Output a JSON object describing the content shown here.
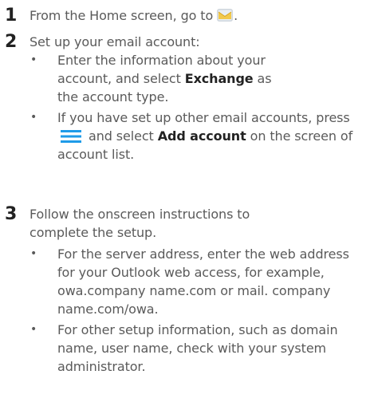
{
  "steps": [
    {
      "number": "1",
      "text_before": "From the Home screen, go to",
      "icon": "mail-app-icon",
      "text_after": "."
    },
    {
      "number": "2",
      "text": "Set up your email account:",
      "bullets": [
        {
          "part1": "Enter the information about your account, and select ",
          "bold1": "Exchange",
          "part2": " as the account type."
        },
        {
          "part1": "If you have set up other email accounts, press ",
          "icon": "menu-icon",
          "part2": " and select ",
          "bold1": "Add account",
          "part3": " on the screen of account list."
        }
      ]
    },
    {
      "number": "3",
      "text": "Follow the onscreen instructions to complete the setup.",
      "bullets": [
        {
          "text": "For the server address, enter the web address for your Outlook web access, for example, owa.company name.com or mail. company name.com/owa."
        },
        {
          "text": "For other setup information, such as domain name, user name, check with your system administrator."
        }
      ]
    }
  ],
  "colors": {
    "body_text": "#5a5a5a",
    "emphasis_text": "#222222",
    "menu_icon": "#1e9be8",
    "mail_icon_envelope": "#f2c94c"
  }
}
